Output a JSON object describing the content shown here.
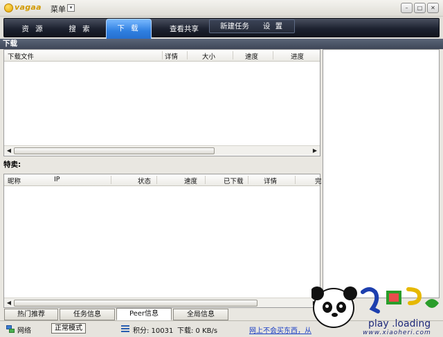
{
  "titlebar": {
    "logo_text": "vagaa",
    "menu_label": "菜单",
    "menu_dropdown_glyph": "▾",
    "window_buttons": [
      "–",
      "□",
      "✕"
    ]
  },
  "nav": {
    "tabs": [
      "资 源",
      "搜 索",
      "下 载",
      "查看共享"
    ],
    "active_index": 2,
    "group_tabs": [
      "新建任务",
      "设 置"
    ]
  },
  "download": {
    "section_title": "下载",
    "columns": [
      "下载文件",
      "详情",
      "大小",
      "速度",
      "进度"
    ]
  },
  "special": {
    "label": "特卖:",
    "columns": [
      "昵称",
      "IP",
      "状态",
      "速度",
      "已下载",
      "详情",
      "完"
    ]
  },
  "bottom_tabs": {
    "items": [
      "热门推荐",
      "任务信息",
      "Peer信息",
      "全局信息"
    ],
    "active_index": 2
  },
  "status": {
    "network_label": "网络",
    "mode": "正常模式",
    "score_label": "积分: 10031",
    "download_speed": "下载: 0 KB/s",
    "ad_text": "网上不会买东西，从"
  },
  "watermark": {
    "subtext": "play .loading",
    "url": "www.xiaoheri.com"
  },
  "colors": {
    "nav_dark": "#1d2230",
    "tab_active": "#2f7fe0",
    "header_strip": "#4b5467",
    "link": "#1b3fc4"
  }
}
